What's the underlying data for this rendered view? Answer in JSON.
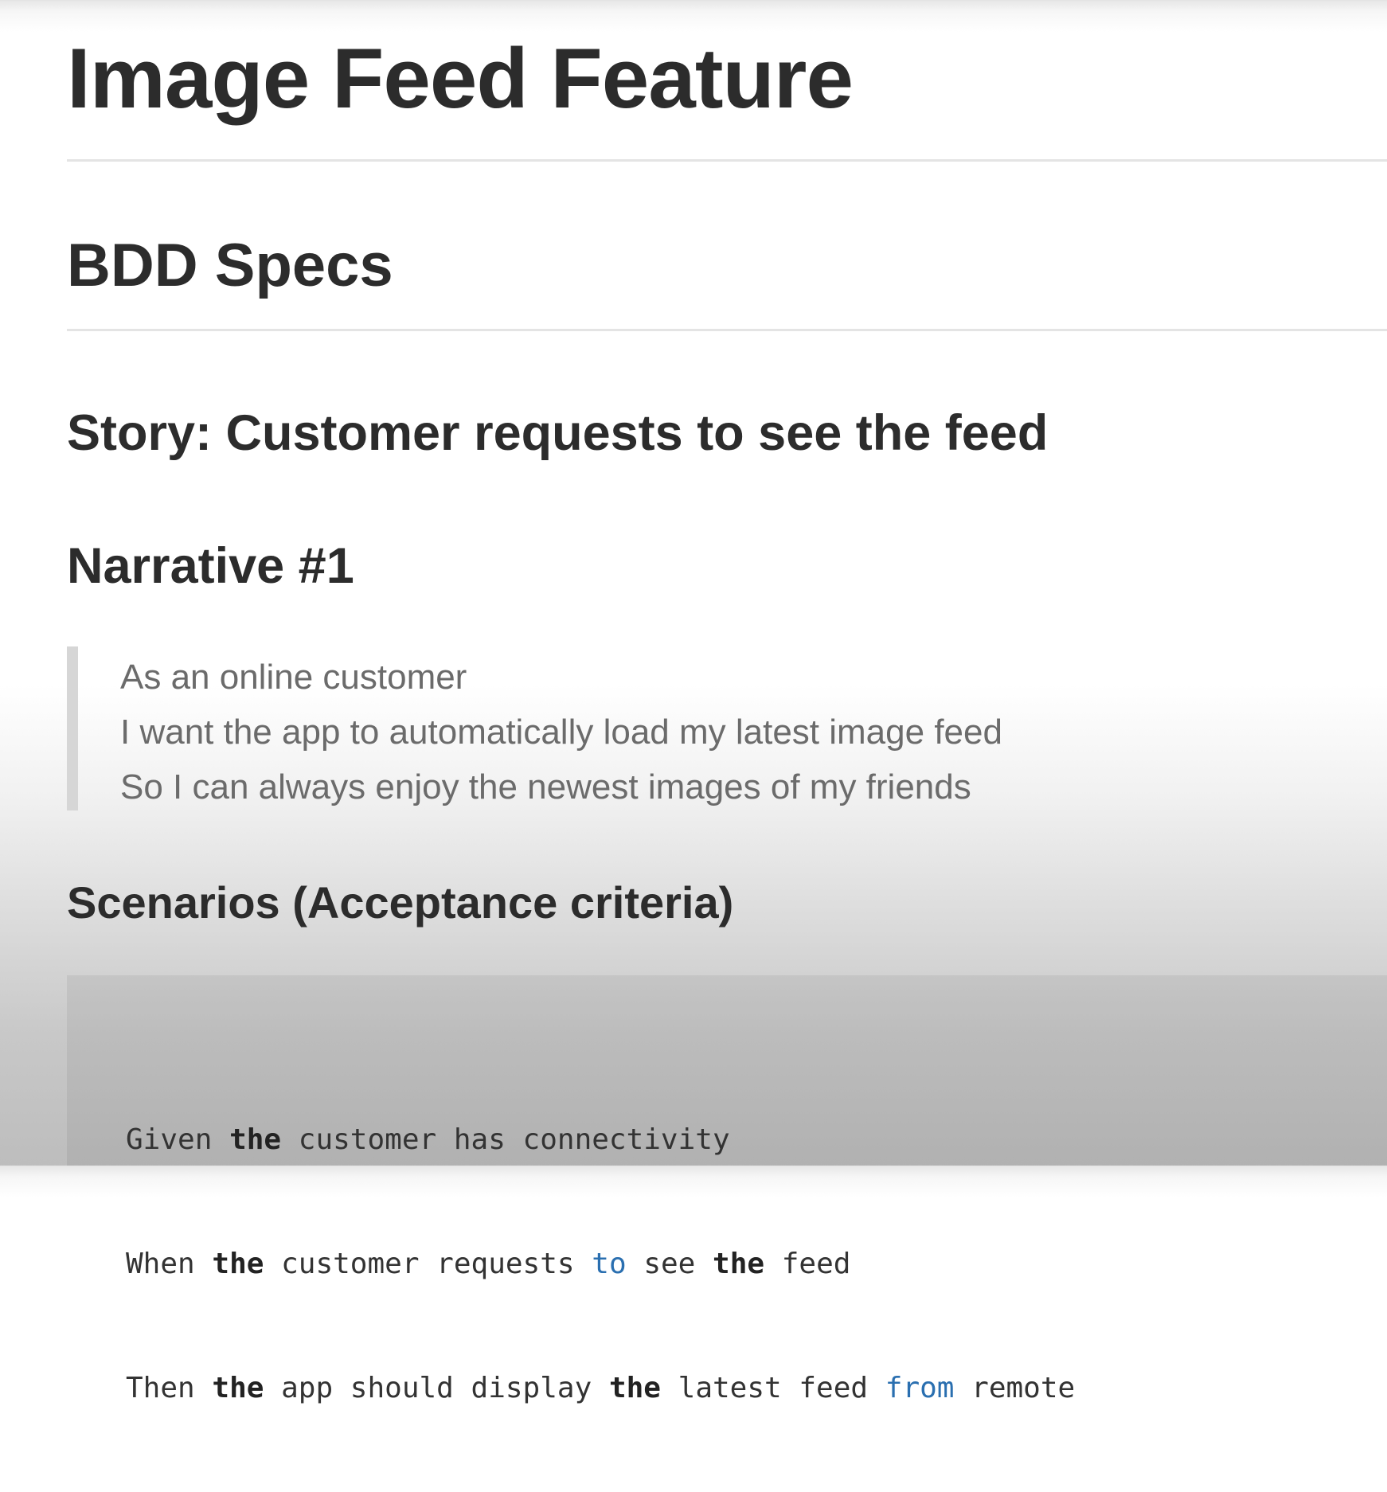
{
  "document": {
    "title": "Image Feed Feature",
    "section_heading": "BDD Specs",
    "story_heading": "Story: Customer requests to see the feed",
    "narrative_heading": "Narrative #1",
    "narrative_lines": [
      "As an online customer",
      "I want the app to automatically load my latest image feed",
      "So I can always enjoy the newest images of my friends"
    ],
    "scenarios_heading": "Scenarios (Acceptance criteria)",
    "code_lines": [
      {
        "w1": "Given",
        "w2": "the",
        "w3": "customer has connectivity"
      },
      {
        "w1": "When",
        "w2": "the",
        "w3": "customer requests",
        "w4": "to",
        "w5": "see",
        "w6": "the",
        "w7": "feed"
      },
      {
        "w1": "Then",
        "w2": "the",
        "w3": "app should display",
        "w4": "the",
        "w5": "latest feed",
        "w6": "from",
        "w7": "remote"
      }
    ]
  },
  "colors": {
    "text": "#2f2f2f",
    "quote_text": "#6b6b6b",
    "quote_bar": "#d6d6d6",
    "rule": "#e4e4e4",
    "code_keyword_blue": "#2a6fb0"
  }
}
